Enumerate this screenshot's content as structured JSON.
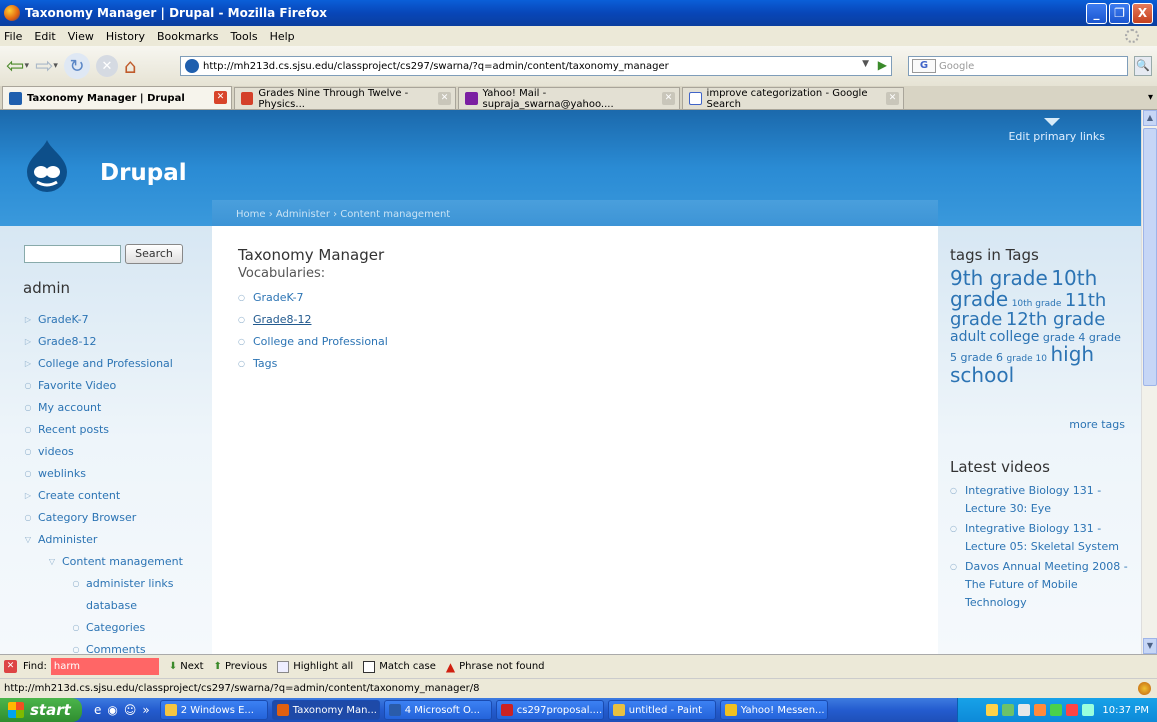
{
  "window": {
    "title": "Taxonomy Manager | Drupal - Mozilla Firefox",
    "minimize": "_",
    "maximize": "❐",
    "close": "X"
  },
  "menu": [
    "File",
    "Edit",
    "View",
    "History",
    "Bookmarks",
    "Tools",
    "Help"
  ],
  "navbar": {
    "url": "http://mh213d.cs.sjsu.edu/classproject/cs297/swarna/?q=admin/content/taxonomy_manager",
    "search_engine": "G",
    "search_placeholder": "Google"
  },
  "tabs": [
    {
      "label": "Taxonomy Manager | Drupal",
      "active": true
    },
    {
      "label": "Grades Nine Through Twelve - Physics...",
      "active": false
    },
    {
      "label": "Yahoo! Mail - supraja_swarna@yahoo....",
      "active": false
    },
    {
      "label": "improve categorization - Google Search",
      "active": false
    }
  ],
  "site": {
    "name": "Drupal",
    "primary_links": "Edit primary links",
    "breadcrumb": "Home › Administer › Content management"
  },
  "sidebar": {
    "search_button": "Search",
    "username": "admin",
    "items": [
      {
        "label": "GradeK-7",
        "bullet": "▷",
        "indent": 0
      },
      {
        "label": "Grade8-12",
        "bullet": "▷",
        "indent": 0
      },
      {
        "label": "College and Professional",
        "bullet": "▷",
        "indent": 0
      },
      {
        "label": "Favorite Video",
        "bullet": "○",
        "indent": 0
      },
      {
        "label": "My account",
        "bullet": "○",
        "indent": 0
      },
      {
        "label": "Recent posts",
        "bullet": "○",
        "indent": 0
      },
      {
        "label": "videos",
        "bullet": "○",
        "indent": 0
      },
      {
        "label": "weblinks",
        "bullet": "○",
        "indent": 0
      },
      {
        "label": "Create content",
        "bullet": "▷",
        "indent": 0
      },
      {
        "label": "Category Browser",
        "bullet": "○",
        "indent": 0
      },
      {
        "label": "Administer",
        "bullet": "▽",
        "indent": 0
      },
      {
        "label": "Content management",
        "bullet": "▽",
        "indent": 1
      },
      {
        "label": "administer links",
        "bullet": "○",
        "indent": 2
      },
      {
        "label": "database",
        "bullet": "",
        "indent": 2
      },
      {
        "label": "Categories",
        "bullet": "○",
        "indent": 2
      },
      {
        "label": "Comments",
        "bullet": "○",
        "indent": 2
      }
    ]
  },
  "main": {
    "title": "Taxonomy Manager",
    "vocab_label": "Vocabularies:",
    "vocabularies": [
      "GradeK-7",
      "Grade8-12",
      "College and Professional",
      "Tags"
    ]
  },
  "right": {
    "tags_title": "tags in Tags",
    "tags": [
      {
        "text": "9th grade",
        "size": "t6"
      },
      {
        "text": "10th grade",
        "size": "t6"
      },
      {
        "text": "10th grade",
        "size": "t1"
      },
      {
        "text": "11th grade",
        "size": "t5"
      },
      {
        "text": "12th grade",
        "size": "t5"
      },
      {
        "text": "adult",
        "size": "t4"
      },
      {
        "text": "college",
        "size": "t4"
      },
      {
        "text": "grade 4",
        "size": "t2"
      },
      {
        "text": "grade 5",
        "size": "t2"
      },
      {
        "text": "grade 6",
        "size": "t2"
      },
      {
        "text": "grade 10",
        "size": "t1"
      },
      {
        "text": "high school",
        "size": "t6"
      }
    ],
    "more_tags": "more tags",
    "videos_title": "Latest videos",
    "videos": [
      "Integrative Biology 131 - Lecture 30: Eye",
      "Integrative Biology 131 - Lecture 05: Skeletal System",
      "Davos Annual Meeting 2008 - The Future of Mobile Technology"
    ]
  },
  "findbar": {
    "label": "Find:",
    "query": "harm",
    "next": "Next",
    "previous": "Previous",
    "highlight": "Highlight all",
    "match_case": "Match case",
    "status": "Phrase not found"
  },
  "status": {
    "text": "http://mh213d.cs.sjsu.edu/classproject/cs297/swarna/?q=admin/content/taxonomy_manager/8"
  },
  "taskbar": {
    "start": "start",
    "tasks": [
      {
        "label": "2 Windows E...",
        "color": "#f4c542"
      },
      {
        "label": "Taxonomy Man...",
        "color": "#e06010"
      },
      {
        "label": "4 Microsoft O...",
        "color": "#2a5caa"
      },
      {
        "label": "cs297proposal....",
        "color": "#cc2222"
      },
      {
        "label": "untitled - Paint",
        "color": "#e8c040"
      },
      {
        "label": "Yahoo! Messen...",
        "color": "#f0c020"
      }
    ],
    "clock": "10:37 PM"
  }
}
